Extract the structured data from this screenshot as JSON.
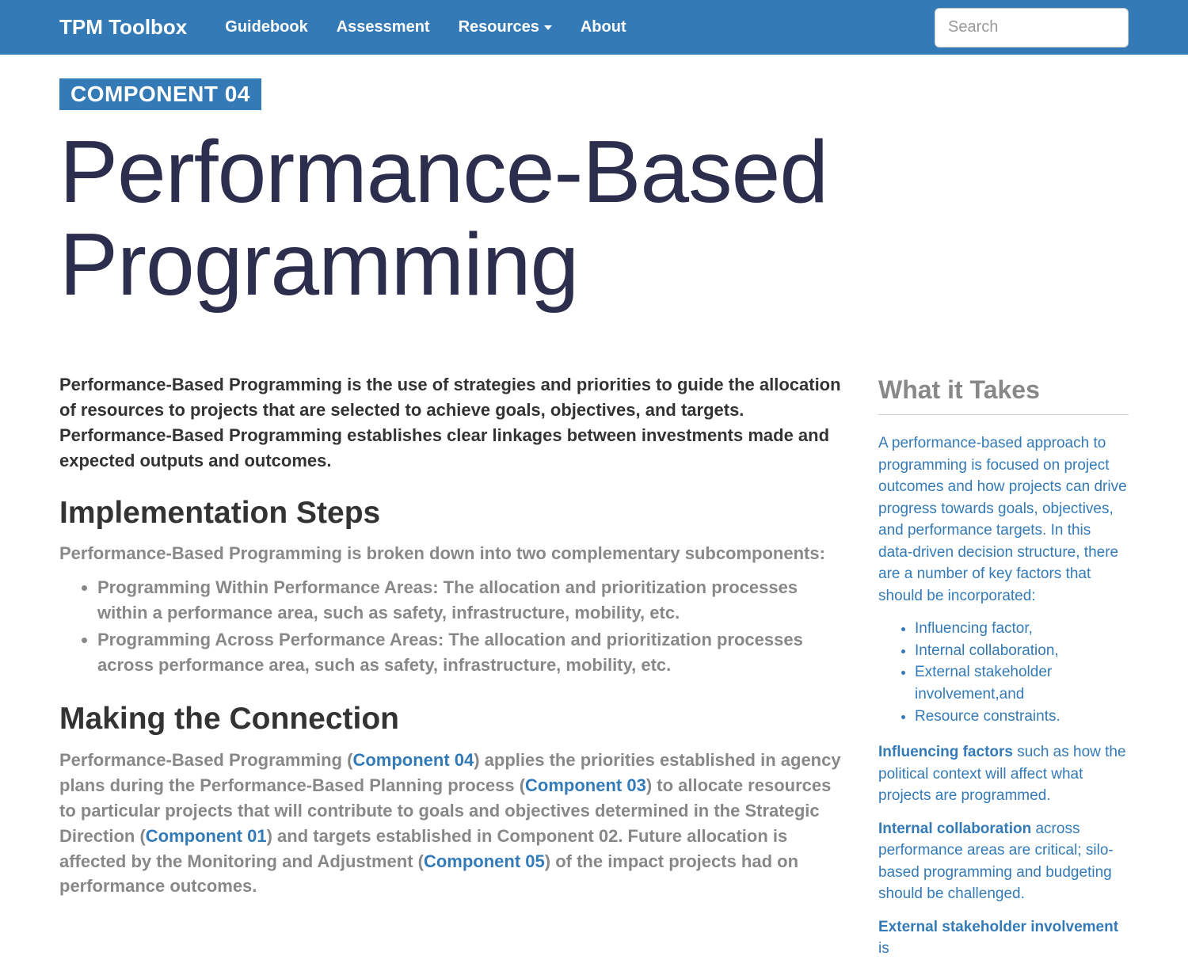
{
  "nav": {
    "brand": "TPM Toolbox",
    "links": [
      "Guidebook",
      "Assessment",
      "Resources",
      "About"
    ],
    "search_placeholder": "Search"
  },
  "header": {
    "tag": "COMPONENT 04",
    "title": "Performance-Based Programming"
  },
  "intro": "Performance-Based Programming is the use of strategies and priorities to guide the allocation of resources to projects that are selected to achieve goals, objectives, and targets. Performance-Based Programming establishes clear linkages between investments made and expected outputs and outcomes.",
  "section1": {
    "heading": "Implementation Steps",
    "sub": "Performance-Based Programming is broken down into two complementary subcomponents:",
    "bullets": [
      "Programming Within Performance Areas: The allocation and prioritization processes within a performance area, such as safety, infrastructure, mobility, etc.",
      "Programming Across Performance Areas: The allocation and prioritization processes across performance area, such as safety, infrastructure, mobility, etc."
    ]
  },
  "section2": {
    "heading": "Making the Connection",
    "p1a": "Performance-Based Programming (",
    "link1": "Component 04",
    "p1b": ") applies the priorities established in agency plans during the Performance-Based Planning process (",
    "link2": "Component 03",
    "p1c": ") to allocate resources to particular projects that will contribute to goals and objectives determined in the Strategic Direction (",
    "link3": "Component 01",
    "p1d": ") and targets established in Component 02. Future allocation is affected by the Monitoring and Adjustment (",
    "link4": "Component 05",
    "p1e": ") of the impact projects had on performance outcomes."
  },
  "sidebar": {
    "title": "What it Takes",
    "p1": "A performance-based approach to programming is focused on project outcomes and how projects can drive progress towards goals, objectives, and performance targets. In this data-driven decision structure, there are a number of key factors that should be incorporated:",
    "bullets": [
      "Influencing factor,",
      "Internal collaboration,",
      "External stakeholder involvement,and",
      "Resource constraints."
    ],
    "p2_strong": "Influencing factors",
    "p2_rest": " such as how the political context will affect what projects are programmed.",
    "p3_strong": "Internal collaboration",
    "p3_rest": " across performance areas are critical; silo-based programming and budgeting should be challenged.",
    "p4_strong": "External stakeholder involvement",
    "p4_rest": " is"
  }
}
